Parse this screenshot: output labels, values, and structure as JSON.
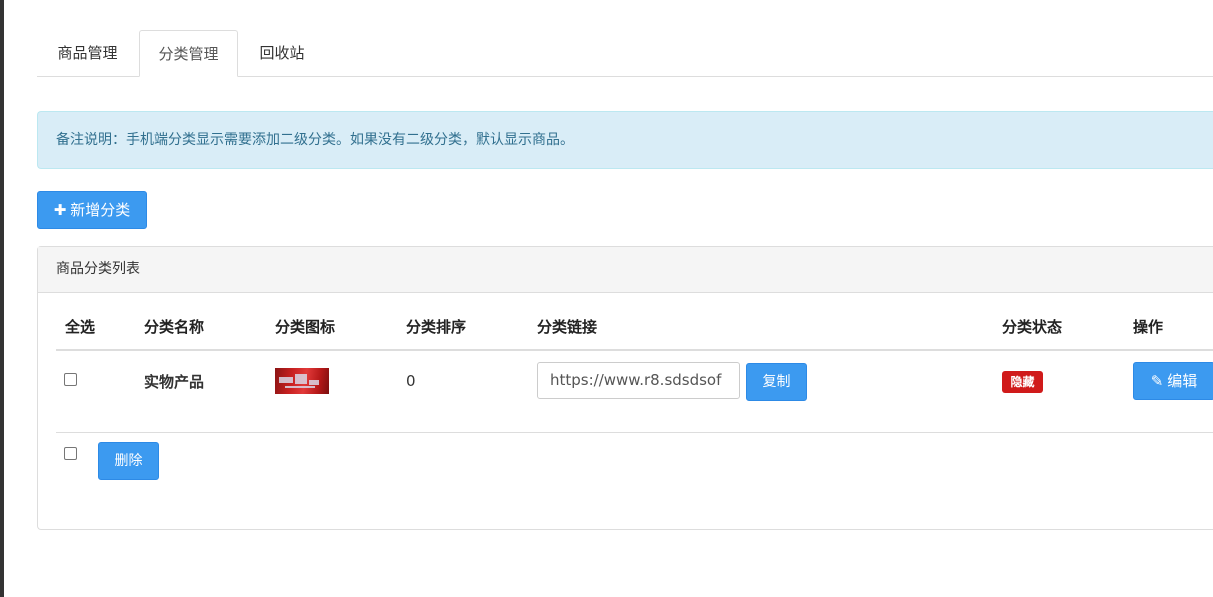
{
  "tabs": [
    {
      "label": "商品管理",
      "active": false
    },
    {
      "label": "分类管理",
      "active": true
    },
    {
      "label": "回收站",
      "active": false
    }
  ],
  "alert": {
    "text": "备注说明：手机端分类显示需要添加二级分类。如果没有二级分类，默认显示商品。"
  },
  "toolbar": {
    "add_label": "新增分类",
    "add_icon": "plus-icon"
  },
  "panel": {
    "title": "商品分类列表"
  },
  "table": {
    "columns": [
      "全选",
      "分类名称",
      "分类图标",
      "分类排序",
      "分类链接",
      "分类状态",
      "操作"
    ],
    "rows": [
      {
        "name": "实物产品",
        "sort": "0",
        "link": "https://www.r8.sdsdsof",
        "copy_label": "复制",
        "status": "隐藏",
        "edit_label": "编辑",
        "edit_icon": "edit-icon"
      }
    ]
  },
  "footer": {
    "delete_label": "删除"
  },
  "colors": {
    "primary": "#3c9af0",
    "danger": "#d01a1a",
    "alert_bg": "#d9edf7",
    "alert_text": "#31708f"
  }
}
